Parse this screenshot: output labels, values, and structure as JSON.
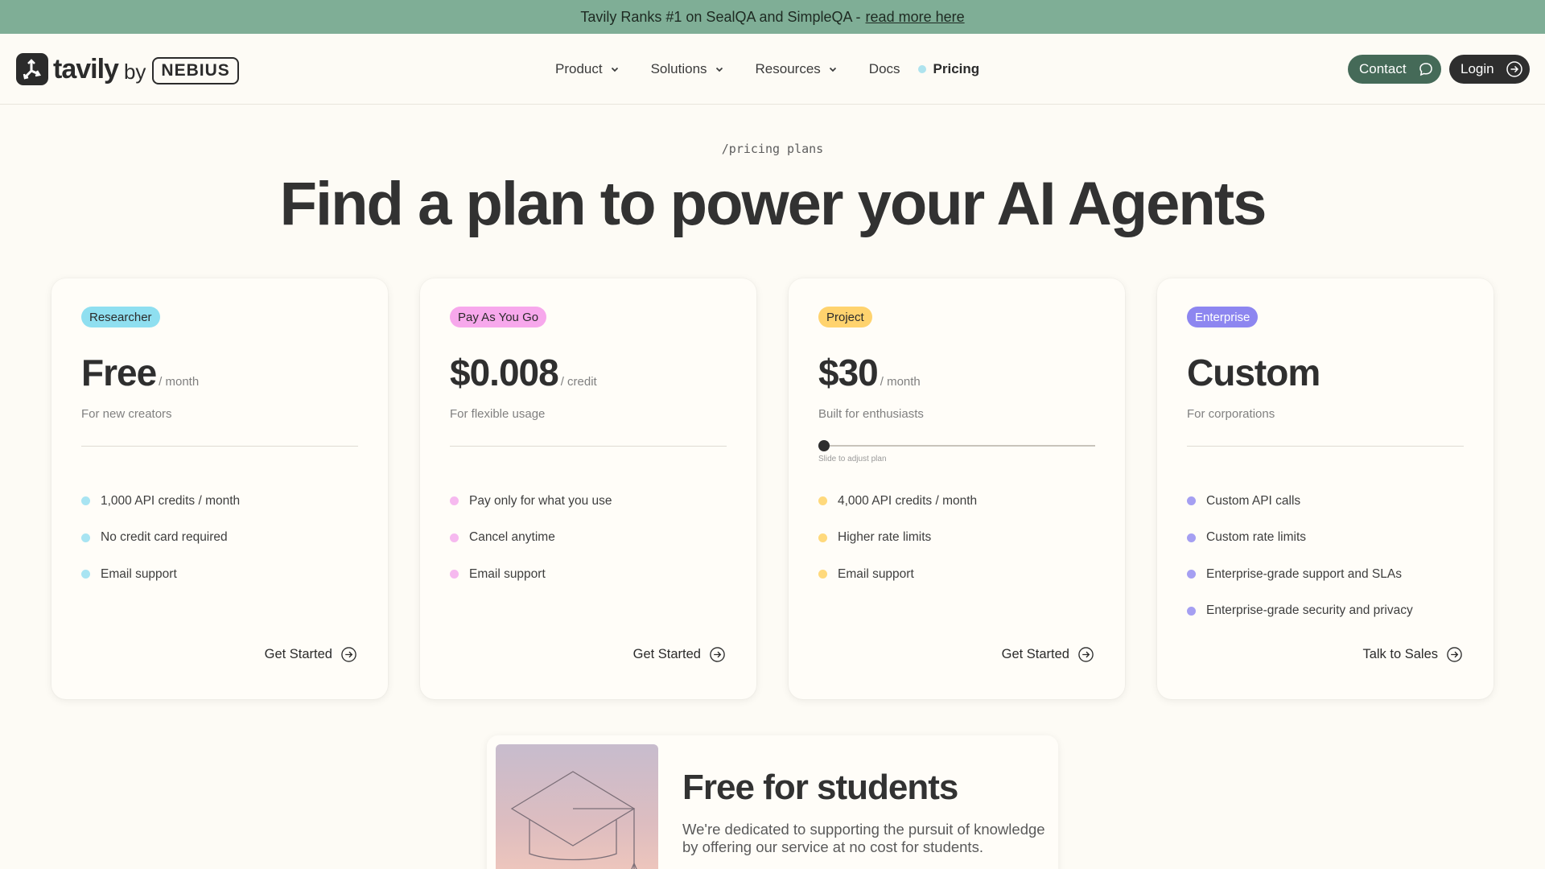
{
  "announcement": {
    "text": "Tavily Ranks #1 on SealQA and SimpleQA -",
    "link": "read more here"
  },
  "nav": {
    "brand": "tavily",
    "by": "by",
    "partner": "NEBIUS",
    "items": [
      {
        "label": "Product",
        "icon": "chevron-down-icon"
      },
      {
        "label": "Solutions",
        "icon": "chevron-down-icon"
      },
      {
        "label": "Resources",
        "icon": "chevron-down-icon"
      },
      {
        "label": "Docs"
      },
      {
        "label": "Pricing",
        "active": true
      }
    ],
    "contact_label": "Contact",
    "login_label": "Login"
  },
  "hero": {
    "eyebrow": "/pricing plans",
    "title": "Find a plan to power your AI Agents"
  },
  "plans": [
    {
      "badge": "Researcher",
      "badge_color": "#8fdff0",
      "price": "Free",
      "unit": "/ month",
      "description": "For new creators",
      "dot_color": "#a8e4f2",
      "features": [
        "1,000 API credits / month",
        "No credit card required",
        "Email support"
      ],
      "cta": "Get Started"
    },
    {
      "badge": "Pay As You Go",
      "badge_color": "#f7a8ec",
      "price": "$0.008",
      "unit": "/ credit",
      "description": "For flexible usage",
      "dot_color": "#f6b9ef",
      "features": [
        "Pay only for what you use",
        "Cancel anytime",
        "Email support"
      ],
      "cta": "Get Started"
    },
    {
      "badge": "Project",
      "badge_color": "#ffd36e",
      "price": "$30",
      "unit": "/ month",
      "description": "Built for enthusiasts",
      "slider_hint": "Slide to adjust plan",
      "slider_value": 0,
      "dot_color": "#ffd97c",
      "features": [
        "4,000 API credits / month",
        "Higher rate limits",
        "Email support"
      ],
      "cta": "Get Started"
    },
    {
      "badge": "Enterprise",
      "badge_color": "#8d86f0",
      "badge_text_color": "#ffffff",
      "price": "Custom",
      "unit": "",
      "description": "For corporations",
      "dot_color": "#a59ff2",
      "features": [
        "Custom API calls",
        "Custom rate limits",
        "Enterprise-grade support and SLAs",
        "Enterprise-grade security and privacy"
      ],
      "cta": "Talk to Sales"
    }
  ],
  "students": {
    "title": "Free for students",
    "body": "We're dedicated to supporting the pursuit of knowledge by offering our service at no cost for students.",
    "icon": "graduation-cap-icon"
  }
}
